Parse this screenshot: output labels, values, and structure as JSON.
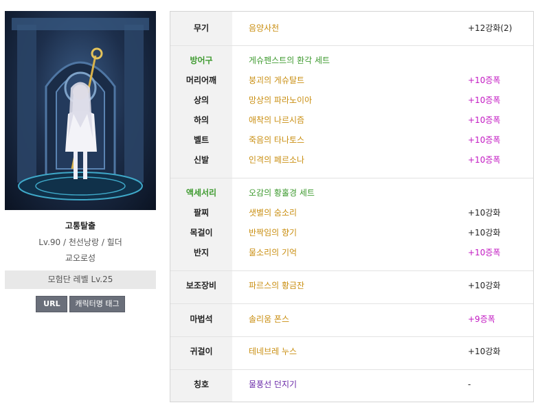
{
  "character": {
    "name": "고통탈출",
    "info": "Lv.90 / 천선낭랑 / 힐더",
    "guild": "교오로성",
    "adventure_level": "모험단 레벨 Lv.25"
  },
  "buttons": {
    "url": "URL",
    "tag": "캐릭터명 태그"
  },
  "equipment": {
    "weapon": {
      "label": "무기",
      "item": "음양사천",
      "enh": "+12강화(2)"
    },
    "armor_header": {
      "label": "방어구",
      "set": "게슈펜스트의 환각 세트"
    },
    "armor": [
      {
        "label": "머리어깨",
        "item": "붕괴의 게슈탈트",
        "enh": "+10증폭"
      },
      {
        "label": "상의",
        "item": "망상의 파라노이아",
        "enh": "+10증폭"
      },
      {
        "label": "하의",
        "item": "애착의 나르시즘",
        "enh": "+10증폭"
      },
      {
        "label": "벨트",
        "item": "죽음의 타나토스",
        "enh": "+10증폭"
      },
      {
        "label": "신발",
        "item": "인격의 페르소나",
        "enh": "+10증폭"
      }
    ],
    "accessory_header": {
      "label": "액세서리",
      "set": "오감의 황홀경 세트"
    },
    "accessories": [
      {
        "label": "팔찌",
        "item": "샛별의 숨소리",
        "enh": "+10강화"
      },
      {
        "label": "목걸이",
        "item": "반짝임의 향기",
        "enh": "+10강화"
      },
      {
        "label": "반지",
        "item": "물소리의 기억",
        "enh": "+10증폭"
      }
    ],
    "subweapon": {
      "label": "보조장비",
      "item": "파르스의 황금잔",
      "enh": "+10강화"
    },
    "magicstone": {
      "label": "마법석",
      "item": "솔리움 폰스",
      "enh": "+9증폭"
    },
    "earring": {
      "label": "귀걸이",
      "item": "테네브레 누스",
      "enh": "+10강화"
    },
    "title": {
      "label": "칭호",
      "item": "물풍선 던지기",
      "enh": "-"
    }
  },
  "colors": {
    "item_orange": "#c98e10",
    "section_green": "#3e9a2f",
    "amplify_magenta": "#c218c2",
    "title_purple": "#6a2aa8"
  }
}
